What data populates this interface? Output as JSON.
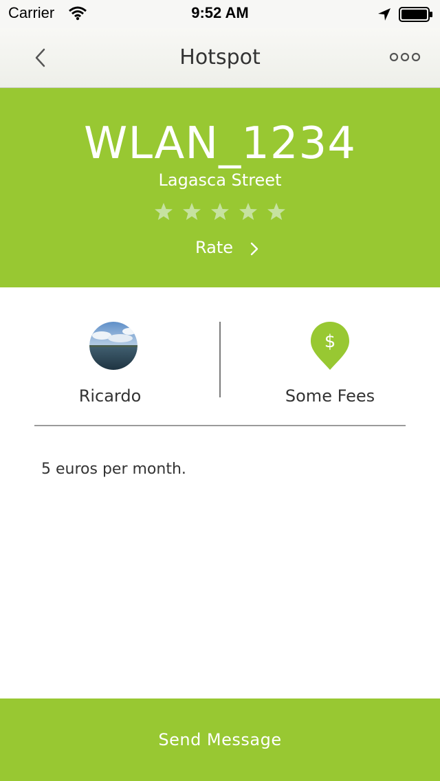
{
  "status_bar": {
    "carrier": "Carrier",
    "time": "9:52 AM"
  },
  "nav": {
    "title": "Hotspot",
    "back_icon": "chevron-left-icon",
    "more_icon": "more-dots-icon"
  },
  "hotspot": {
    "ssid": "WLAN_1234",
    "street": "Lagasca Street",
    "rating": {
      "value": 0,
      "max": 5
    },
    "rate_label": "Rate"
  },
  "info": {
    "owner_name": "Ricardo",
    "fee_label": "Some Fees",
    "fee_icon": "dollar-pin-icon"
  },
  "description": "5 euros per month.",
  "footer": {
    "send_label": "Send Message"
  },
  "colors": {
    "accent": "#98c832",
    "star_empty": "#c6e2a0",
    "text": "#333333"
  }
}
